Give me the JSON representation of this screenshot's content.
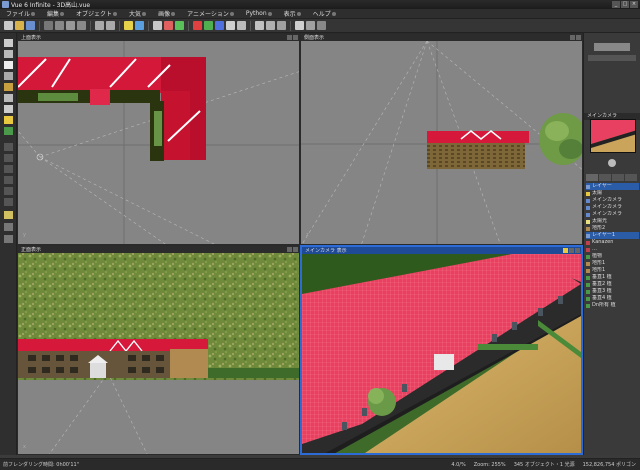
{
  "window": {
    "title": "Vue 6 Infinite - 3D高山.vue"
  },
  "menu": [
    {
      "label": "ファイル",
      "icon": "circle-icon"
    },
    {
      "label": "編集",
      "icon": "circle-icon"
    },
    {
      "label": "オブジェクト",
      "icon": "circle-icon"
    },
    {
      "label": "大気",
      "icon": "circle-icon"
    },
    {
      "label": "画像",
      "icon": "circle-icon"
    },
    {
      "label": "アニメーション",
      "icon": "circle-icon"
    },
    {
      "label": "Python",
      "icon": "circle-icon"
    },
    {
      "label": "表示",
      "icon": "circle-icon"
    },
    {
      "label": "ヘルプ",
      "icon": "circle-icon"
    }
  ],
  "viewports": {
    "top": {
      "title": "上面表示"
    },
    "side": {
      "title": "側面表示"
    },
    "front": {
      "title": "正面表示"
    },
    "camera": {
      "title": "メインカメラ 表示"
    }
  },
  "axes": {
    "x": "x",
    "y": "y",
    "z": "z"
  },
  "right_panel": {
    "camera_label": "メインカメラ",
    "tree": [
      {
        "label": "レイヤー",
        "icon": "layer-icon",
        "selected": true
      },
      {
        "label": "太陽",
        "icon": "sun-icon",
        "selected": false
      },
      {
        "label": "メインカメラ",
        "icon": "camera-icon",
        "selected": false
      },
      {
        "label": "メインカメラ",
        "icon": "camera-icon",
        "selected": false
      },
      {
        "label": "メインカメラ",
        "icon": "camera-icon",
        "selected": false
      },
      {
        "label": "太陽光",
        "icon": "light-icon",
        "selected": false
      },
      {
        "label": "地形2",
        "icon": "terrain-icon",
        "selected": false
      },
      {
        "label": "レイヤー1",
        "icon": "layer-icon",
        "selected": true
      },
      {
        "label": "Kanazen",
        "icon": "object-icon",
        "selected": false
      },
      {
        "label": "…",
        "icon": "object-icon",
        "selected": false
      },
      {
        "label": "植物",
        "icon": "plant-icon",
        "selected": false
      },
      {
        "label": "地形1",
        "icon": "terrain-icon",
        "selected": false
      },
      {
        "label": "地形1",
        "icon": "terrain-icon",
        "selected": false
      },
      {
        "label": "垂直1 植",
        "icon": "plant-icon",
        "selected": false
      },
      {
        "label": "垂直2 植",
        "icon": "plant-icon",
        "selected": false
      },
      {
        "label": "垂直3 植",
        "icon": "plant-icon",
        "selected": false
      },
      {
        "label": "垂直4 植",
        "icon": "plant-icon",
        "selected": false
      },
      {
        "label": "Dn所有 植",
        "icon": "plant-icon",
        "selected": false
      }
    ]
  },
  "status": {
    "left": "前フレンダリング時間: 0h00'11\"",
    "mid1": "4.0/%",
    "zoom": "Zoom: 255%",
    "objects": "345 オブジェクト・1 光源",
    "polys": "152,826,754 ポリゴン"
  }
}
